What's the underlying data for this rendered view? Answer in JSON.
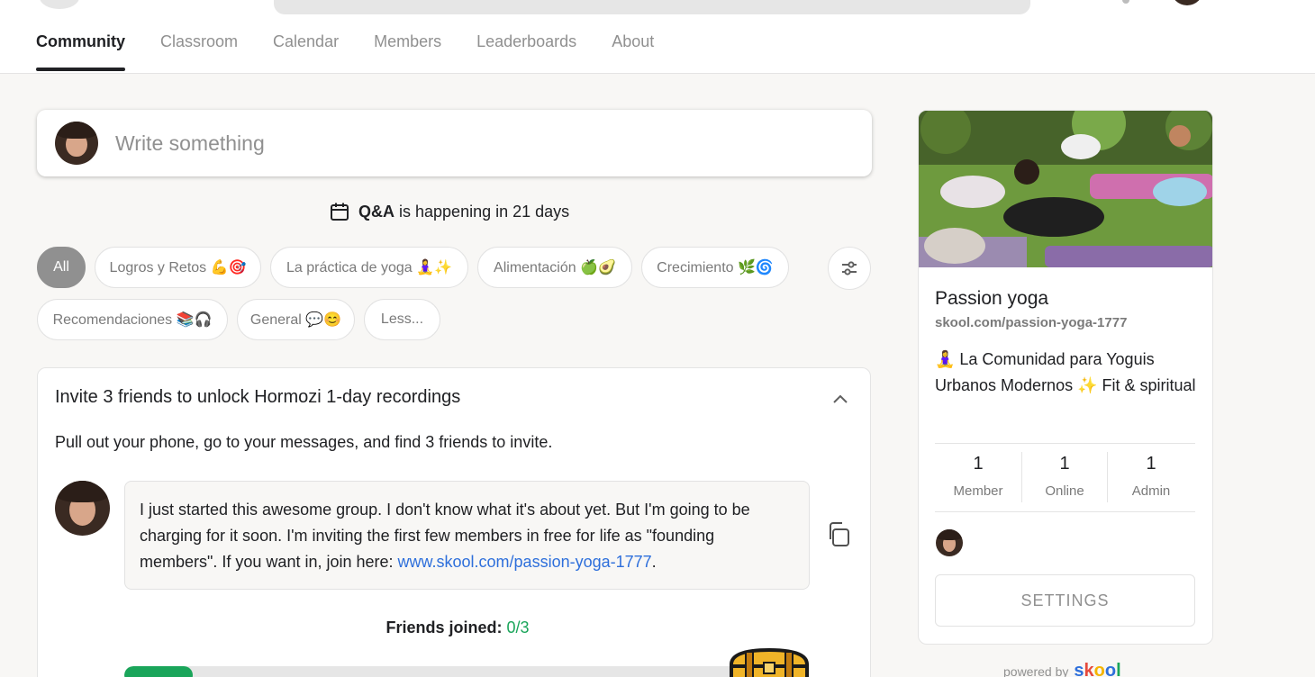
{
  "nav": {
    "tabs": [
      {
        "label": "Community",
        "active": true
      },
      {
        "label": "Classroom",
        "active": false
      },
      {
        "label": "Calendar",
        "active": false
      },
      {
        "label": "Members",
        "active": false
      },
      {
        "label": "Leaderboards",
        "active": false
      },
      {
        "label": "About",
        "active": false
      }
    ]
  },
  "composer": {
    "placeholder": "Write something"
  },
  "event": {
    "title": "Q&A",
    "suffix": "is happening in 21 days"
  },
  "categories": [
    {
      "label": "All",
      "active": true
    },
    {
      "label": "Logros y Retos 💪🎯"
    },
    {
      "label": "La práctica de yoga 🧘‍♀️✨"
    },
    {
      "label": "Alimentación 🍏🥑"
    },
    {
      "label": "Crecimiento 🌿🌀"
    },
    {
      "label": "Recomendaciones 📚🎧"
    },
    {
      "label": "General 💬😊"
    },
    {
      "label": "Less..."
    }
  ],
  "invite": {
    "title": "Invite 3 friends to unlock Hormozi 1-day recordings",
    "subtitle": "Pull out your phone, go to your messages, and find 3 friends to invite.",
    "message": "I just started this awesome group. I don't know what it's about yet. But I'm going to be charging for it soon. I'm inviting the first few members in free for life as \"founding members\". If you want in, join here: ",
    "link": "www.skool.com/passion-yoga-1777",
    "message_end": ".",
    "friends_label": "Friends joined: ",
    "friends_count": "0/3",
    "progress_fraction": 0.11
  },
  "group": {
    "name": "Passion yoga",
    "url": "skool.com/passion-yoga-1777",
    "description": "🧘‍♀️ La Comunidad para Yoguis Urbanos Modernos ✨ Fit & spiritual",
    "stats": [
      {
        "value": "1",
        "label": "Member"
      },
      {
        "value": "1",
        "label": "Online"
      },
      {
        "value": "1",
        "label": "Admin"
      }
    ],
    "settings_label": "SETTINGS"
  },
  "footer": {
    "powered_by": "powered by",
    "brand": "skool"
  },
  "colors": {
    "accent_green": "#1aa55a",
    "link_blue": "#2e6fdb",
    "active_chip": "#909090"
  },
  "icons": [
    "calendar-icon",
    "filter-icon",
    "chevron-up-icon",
    "copy-icon",
    "treasure-chest-icon"
  ]
}
